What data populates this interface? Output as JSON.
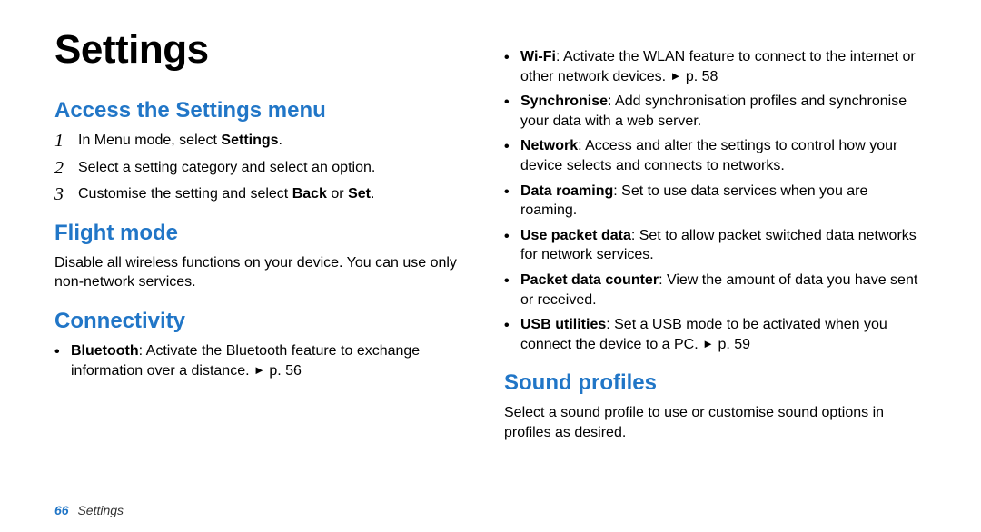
{
  "title": "Settings",
  "left": {
    "access": {
      "heading": "Access the Settings menu",
      "steps": [
        {
          "num": "1",
          "pre": "In Menu mode, select ",
          "bold": "Settings",
          "post": "."
        },
        {
          "num": "2",
          "pre": "Select a setting category and select an option.",
          "bold": "",
          "post": ""
        },
        {
          "num": "3",
          "pre": "Customise the setting and select ",
          "bold": "Back",
          "mid": " or ",
          "bold2": "Set",
          "post": "."
        }
      ]
    },
    "flight": {
      "heading": "Flight mode",
      "body": "Disable all wireless functions on your device. You can use only non-network services."
    },
    "connectivity": {
      "heading": "Connectivity",
      "items": [
        {
          "bold": "Bluetooth",
          "text": ": Activate the Bluetooth feature to exchange information over a distance. ",
          "arrow": "►",
          "ref": " p. 56"
        }
      ]
    }
  },
  "right": {
    "conn_items": [
      {
        "bold": "Wi-Fi",
        "text": ": Activate the WLAN feature to connect to the internet or other network devices. ",
        "arrow": "►",
        "ref": " p. 58"
      },
      {
        "bold": "Synchronise",
        "text": ": Add synchronisation profiles and synchronise your data with a web server."
      },
      {
        "bold": "Network",
        "text": ": Access and alter the settings to control how your device selects and connects to networks."
      },
      {
        "bold": "Data roaming",
        "text": ": Set to use data services when you are roaming."
      },
      {
        "bold": "Use packet data",
        "text": ": Set to allow packet switched data networks for network services."
      },
      {
        "bold": "Packet data counter",
        "text": ": View the amount of data you have sent or received."
      },
      {
        "bold": "USB utilities",
        "text": ": Set a USB mode to be activated when you connect the device to a PC. ",
        "arrow": "►",
        "ref": " p. 59"
      }
    ],
    "sound": {
      "heading": "Sound profiles",
      "body": "Select a sound profile to use or customise sound options in profiles as desired."
    }
  },
  "footer": {
    "page": "66",
    "label": "Settings"
  }
}
